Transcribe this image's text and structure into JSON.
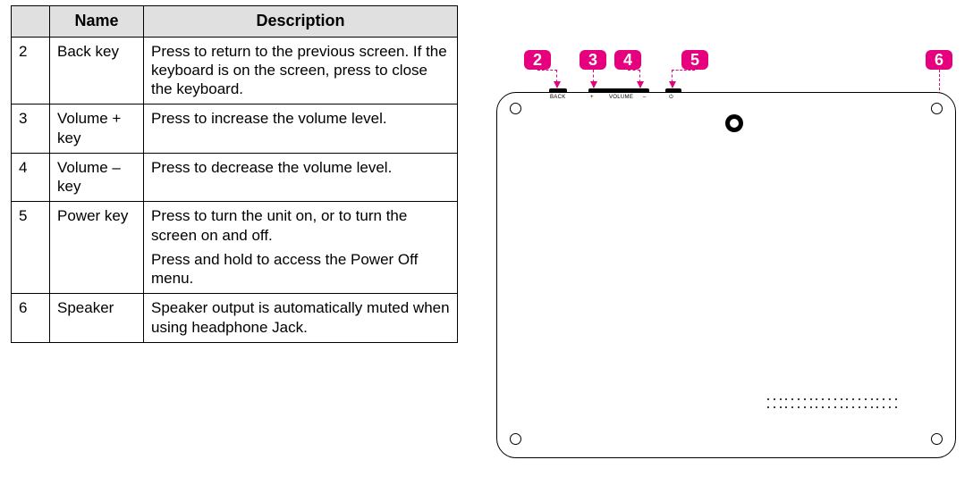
{
  "table": {
    "header_name": "Name",
    "header_desc": "Description",
    "rows": [
      {
        "num": "2",
        "name": "Back key",
        "desc": [
          "Press to return to the previous screen. If the keyboard is on the screen, press to close the keyboard."
        ]
      },
      {
        "num": "3",
        "name": "Volume + key",
        "desc": [
          "Press to increase the volume level."
        ]
      },
      {
        "num": "4",
        "name": "Volume – key",
        "desc": [
          "Press to decrease the volume level."
        ]
      },
      {
        "num": "5",
        "name": "Power key",
        "desc": [
          "Press to turn the unit on, or to turn the screen on and off.",
          "Press and hold to access the Power Off menu."
        ]
      },
      {
        "num": "6",
        "name": "Speaker",
        "desc": [
          "Speaker output is automatically muted when using headphone Jack."
        ]
      }
    ]
  },
  "edge_labels": {
    "back": "BACK",
    "plus": "+",
    "volume": "VOLUME",
    "minus": "–",
    "power": "⏻"
  },
  "callouts": {
    "c2": "2",
    "c3": "3",
    "c4": "4",
    "c5": "5",
    "c6": "6"
  },
  "colors": {
    "accent": "#e6007e",
    "header_bg": "#e0e0e0"
  },
  "chart_data": {
    "type": "table",
    "columns": [
      "#",
      "Name",
      "Description"
    ],
    "rows": [
      [
        "2",
        "Back key",
        "Press to return to the previous screen. If the keyboard is on the screen, press to close the keyboard."
      ],
      [
        "3",
        "Volume + key",
        "Press to increase the volume level."
      ],
      [
        "4",
        "Volume – key",
        "Press to decrease the volume level."
      ],
      [
        "5",
        "Power key",
        "Press to turn the unit on, or to turn the screen on and off. Press and hold to access the Power Off menu."
      ],
      [
        "6",
        "Speaker",
        "Speaker output is automatically muted when using headphone Jack."
      ]
    ]
  }
}
